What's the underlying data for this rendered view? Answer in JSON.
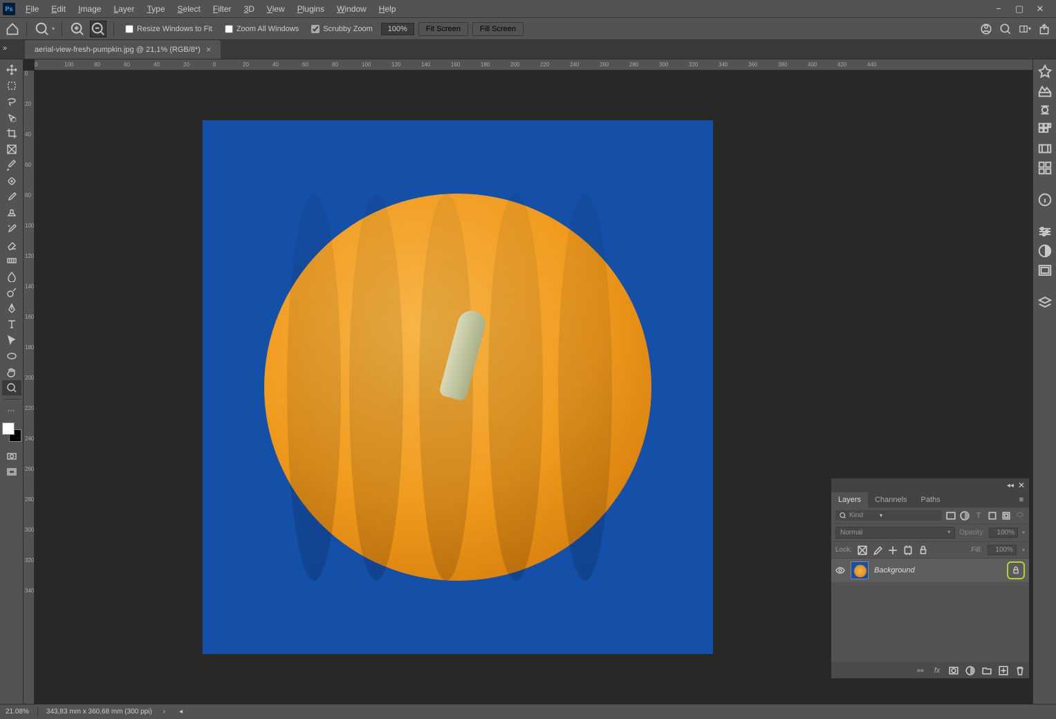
{
  "menubar": {
    "items": [
      {
        "label": "File",
        "u": "F"
      },
      {
        "label": "Edit",
        "u": "E"
      },
      {
        "label": "Image",
        "u": "I"
      },
      {
        "label": "Layer",
        "u": "L"
      },
      {
        "label": "Type",
        "u": "T"
      },
      {
        "label": "Select",
        "u": "S"
      },
      {
        "label": "Filter",
        "u": "F"
      },
      {
        "label": "3D",
        "u": "3"
      },
      {
        "label": "View",
        "u": "V"
      },
      {
        "label": "Plugins",
        "u": "P"
      },
      {
        "label": "Window",
        "u": "W"
      },
      {
        "label": "Help",
        "u": "H"
      }
    ]
  },
  "optionsbar": {
    "resize_windows": "Resize Windows to Fit",
    "zoom_all": "Zoom All Windows",
    "scrubby": "Scrubby Zoom",
    "zoom_pct": "100%",
    "fit_screen": "Fit Screen",
    "fill_screen": "Fill Screen"
  },
  "tab": {
    "title": "aerial-view-fresh-pumpkin.jpg @ 21,1% (RGB/8*)"
  },
  "ruler_h": [
    "0",
    "100",
    "80",
    "60",
    "40",
    "20",
    "0",
    "20",
    "40",
    "60",
    "80",
    "100",
    "120",
    "140",
    "160",
    "180",
    "200",
    "220",
    "240",
    "260",
    "280",
    "300",
    "320",
    "340",
    "360",
    "380",
    "400",
    "420",
    "440"
  ],
  "ruler_v": [
    "0",
    "20",
    "40",
    "60",
    "80",
    "100",
    "120",
    "140",
    "160",
    "180",
    "200",
    "220",
    "240",
    "260",
    "280",
    "300",
    "320",
    "340"
  ],
  "layers_panel": {
    "tabs": {
      "layers": "Layers",
      "channels": "Channels",
      "paths": "Paths"
    },
    "kind_label": "Kind",
    "blend_mode": "Normal",
    "opacity_label": "Opacity:",
    "opacity_value": "100%",
    "lock_label": "Lock:",
    "fill_label": "Fill:",
    "fill_value": "100%",
    "layer_name": "Background"
  },
  "statusbar": {
    "zoom": "21.08%",
    "dims": "343,83 mm x 360,68 mm (300 ppi)"
  }
}
